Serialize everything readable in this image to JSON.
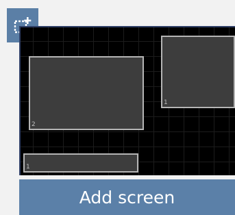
{
  "toolbar": {
    "add_screen_icon": "add-screen-icon"
  },
  "canvas": {
    "screens": [
      {
        "number": "2"
      },
      {
        "number": "1"
      },
      {
        "number": "1"
      }
    ]
  },
  "footer": {
    "add_screen_label": "Add screen"
  },
  "colors": {
    "accent": "#5b80a8",
    "canvas_background": "#000000",
    "screen_fill": "#3d3d3d",
    "screen_border": "#b5b5b5"
  }
}
